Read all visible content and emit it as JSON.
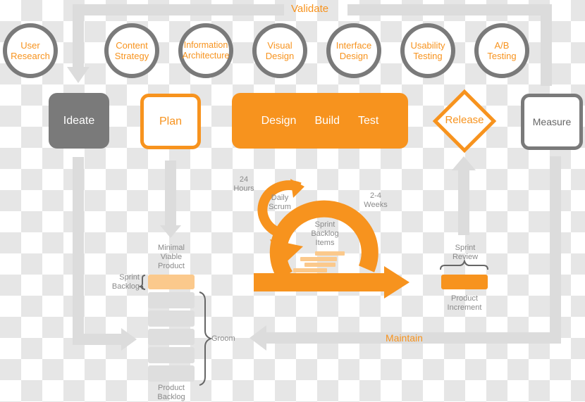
{
  "colors": {
    "accent": "#f7931e",
    "accent_light": "#fbc98c",
    "dark_grey": "#7a7a7a",
    "arrow_grey": "#dcdcdc",
    "label_grey": "#8a8a8a"
  },
  "loops": {
    "validate": "Validate",
    "maintain": "Maintain"
  },
  "activities": [
    {
      "label": "User\nResearch"
    },
    {
      "label": "Content\nStrategy"
    },
    {
      "label": "Information\nArchitecture"
    },
    {
      "label": "Visual\nDesign"
    },
    {
      "label": "Interface\nDesign"
    },
    {
      "label": "Usability\nTesting"
    },
    {
      "label": "A/B\nTesting"
    }
  ],
  "phases": {
    "ideate": "Ideate",
    "plan": "Plan",
    "design": "Design",
    "build": "Build",
    "test": "Test",
    "release": "Release",
    "measure": "Measure"
  },
  "scrum": {
    "hours": "24\nHours",
    "daily_scrum": "Daily\nScrum",
    "weeks": "2-4\nWeeks",
    "sprint_backlog_items": "Sprint\nBacklog\nItems"
  },
  "backlog": {
    "mvp": "Minimal\nViable\nProduct",
    "sprint_backlog": "Sprint\nBacklog",
    "groom": "Groom",
    "product_backlog": "Product\nBacklog"
  },
  "review": {
    "sprint_review": "Sprint\nReview",
    "product_increment": "Product\nIncrement"
  }
}
